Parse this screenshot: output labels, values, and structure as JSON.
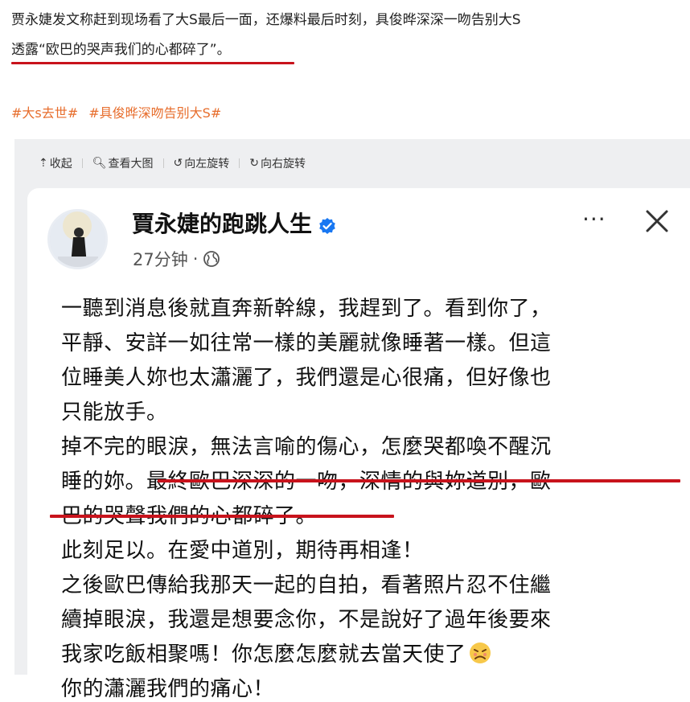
{
  "article": {
    "line1": "贾永婕发文称赶到现场看了大S最后一面，还爆料最后时刻，具俊晔深深一吻告别大S",
    "line2": "透露“欧巴的哭声我们的心都碎了”。"
  },
  "hashtags": [
    "#大s去世#",
    "#具俊晔深吻告别大S#"
  ],
  "toolbar": {
    "collapse": "收起",
    "view_large": "查看大图",
    "rotate_left": "向左旋转",
    "rotate_right": "向右旋转"
  },
  "post": {
    "author": "賈永婕的跑跳人生",
    "time": "27分钟",
    "more": "···",
    "lines": [
      "一聽到消息後就直奔新幹線，我趕到了。看到你了，",
      "平靜、安詳一如往常一樣的美麗就像睡著一樣。但這",
      "位睡美人妳也太瀟灑了，我們還是心很痛，但好像也",
      "只能放手。",
      "掉不完的眼淚，無法言喻的傷心，怎麼哭都喚不醒沉",
      "睡的妳。最終歐巴深深的一吻，深情的與妳道別，歐",
      "巴的哭聲我們的心都碎了。",
      "此刻足以。在愛中道別，期待再相逢！",
      "之後歐巴傳給我那天一起的自拍，看著照片忍不住繼",
      "續掉眼淚，我還是想要念你，不是說好了過年後要來",
      "我家吃飯相聚嗎！你怎麼怎麼就去當天使了",
      "你的瀟灑我們的痛心！"
    ]
  },
  "colors": {
    "underline": "#c8131c",
    "hashtag": "#e76d2c",
    "verified": "#1877f2"
  }
}
